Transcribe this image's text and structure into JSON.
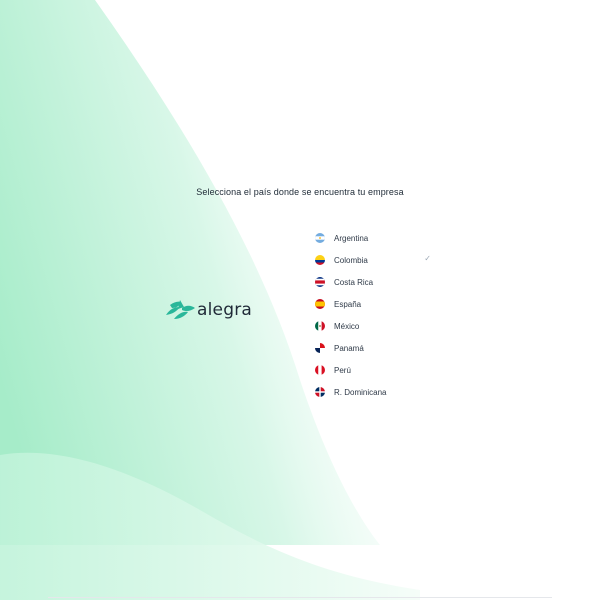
{
  "heading": "Selecciona el país donde se encuentra tu empresa",
  "logo": {
    "wordmark": "alegra",
    "icon": "alegra-leaf-icon",
    "color": "#2ab79a"
  },
  "countries": [
    {
      "label": "Argentina",
      "flag": "argentina-flag-icon",
      "selected": false
    },
    {
      "label": "Colombia",
      "flag": "colombia-flag-icon",
      "selected": true
    },
    {
      "label": "Costa Rica",
      "flag": "costa-rica-flag-icon",
      "selected": false
    },
    {
      "label": "España",
      "flag": "spain-flag-icon",
      "selected": false
    },
    {
      "label": "México",
      "flag": "mexico-flag-icon",
      "selected": false
    },
    {
      "label": "Panamá",
      "flag": "panama-flag-icon",
      "selected": false
    },
    {
      "label": "Perú",
      "flag": "peru-flag-icon",
      "selected": false
    },
    {
      "label": "R. Dominicana",
      "flag": "dominican-republic-flag-icon",
      "selected": false
    }
  ],
  "selected_mark": "✓",
  "colors": {
    "accent_green": "#2ab79a",
    "background_tint": "#b9f0d6"
  }
}
